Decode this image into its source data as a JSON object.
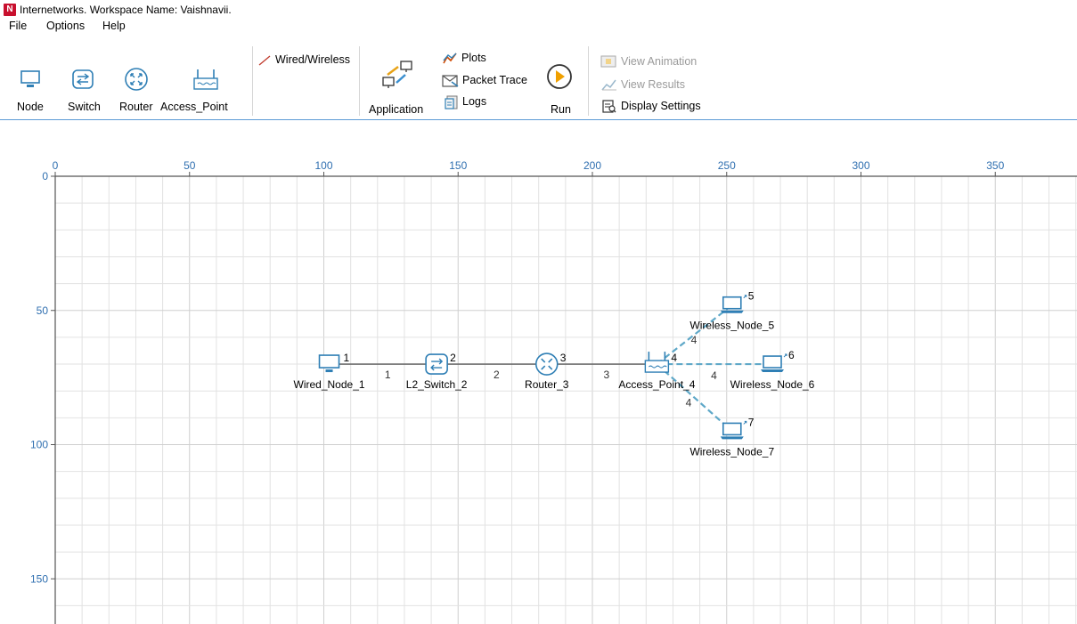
{
  "window": {
    "title": "Internetworks. Workspace Name: Vaishnavii.",
    "logo_text": "N"
  },
  "menu": [
    "File",
    "Options",
    "Help"
  ],
  "ribbon": {
    "devices": [
      "Node",
      "Switch",
      "Router",
      "Access_Point"
    ],
    "link_tool": "Wired/Wireless",
    "application": "Application",
    "outputs": [
      "Plots",
      "Packet Trace",
      "Logs"
    ],
    "run": "Run",
    "view_items": [
      "View Animation",
      "View Results",
      "Display Settings"
    ]
  },
  "grid": {
    "x_ticks": [
      "0",
      "50",
      "100",
      "150",
      "200",
      "250",
      "300",
      "350"
    ],
    "y_ticks": [
      "0",
      "50",
      "100",
      "150"
    ]
  },
  "devices": [
    {
      "id": "1",
      "name": "Wired_Node_1",
      "type": "node",
      "x": 102,
      "y": 70
    },
    {
      "id": "2",
      "name": "L2_Switch_2",
      "type": "switch",
      "x": 142,
      "y": 70
    },
    {
      "id": "3",
      "name": "Router_3",
      "type": "router",
      "x": 183,
      "y": 70
    },
    {
      "id": "4",
      "name": "Access_Point_4",
      "type": "access_point",
      "x": 224,
      "y": 70
    },
    {
      "id": "5",
      "name": "Wireless_Node_5",
      "type": "laptop",
      "x": 252,
      "y": 48
    },
    {
      "id": "6",
      "name": "Wireless_Node_6",
      "type": "laptop",
      "x": 267,
      "y": 70
    },
    {
      "id": "7",
      "name": "Wireless_Node_7",
      "type": "laptop",
      "x": 252,
      "y": 95
    }
  ],
  "links": [
    {
      "id": "1",
      "from": "1",
      "to": "2",
      "kind": "wired"
    },
    {
      "id": "2",
      "from": "2",
      "to": "3",
      "kind": "wired"
    },
    {
      "id": "3",
      "from": "3",
      "to": "4",
      "kind": "wired"
    },
    {
      "id": "4",
      "from": "4",
      "to": "5",
      "kind": "wireless"
    },
    {
      "id": "4",
      "from": "4",
      "to": "6",
      "kind": "wireless"
    },
    {
      "id": "4",
      "from": "4",
      "to": "7",
      "kind": "wireless"
    }
  ],
  "colors": {
    "wired": "#6e6e6e",
    "wireless": "#5fa8c8",
    "icon": "#2f7fb5",
    "accent": "#0078d4",
    "run": "#f0a000"
  }
}
